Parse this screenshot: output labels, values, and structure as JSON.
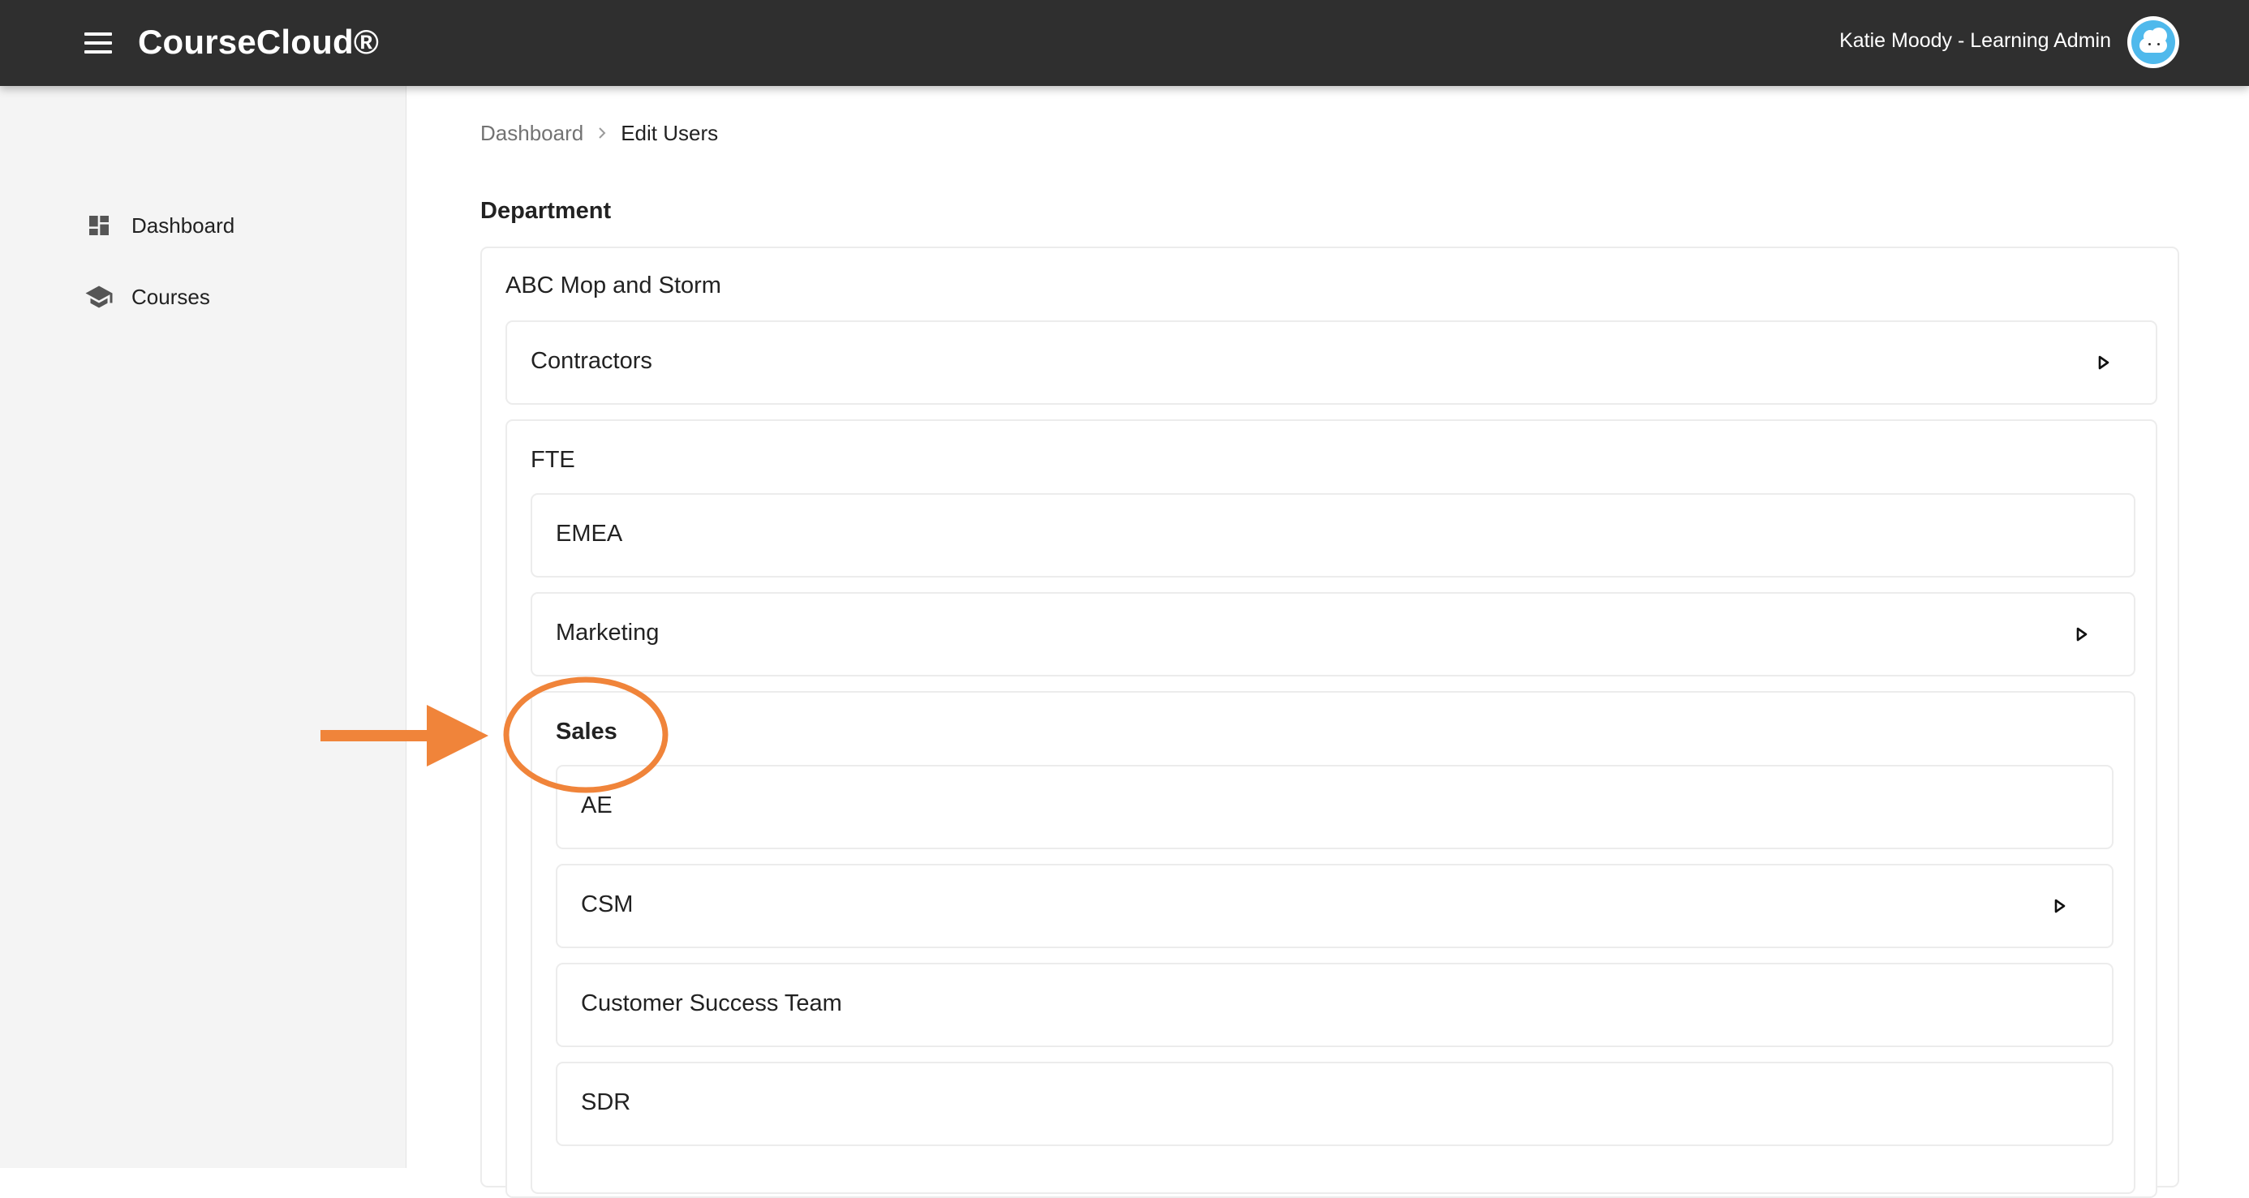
{
  "header": {
    "brand": "CourseCloud®",
    "user": "Katie Moody - Learning Admin"
  },
  "sidebar": {
    "items": [
      {
        "label": "Dashboard",
        "icon": "dashboard-icon"
      },
      {
        "label": "Courses",
        "icon": "graduation-cap-icon"
      }
    ]
  },
  "main": {
    "title": "Dashboard - Edit Users",
    "breadcrumb": {
      "parent": "Dashboard",
      "current": "Edit Users"
    },
    "section_label": "Department",
    "tree": {
      "root": "ABC Mop and Storm",
      "contractors": "Contractors",
      "fte": "FTE",
      "emea": "EMEA",
      "marketing": "Marketing",
      "sales": "Sales",
      "sales_children": [
        "AE",
        "CSM",
        "Customer Success Team",
        "SDR"
      ]
    }
  },
  "colors": {
    "topbar": "#2f2f2f",
    "sidebar": "#f4f4f4",
    "annotation": "#f0843a",
    "avatar": "#4fb9ec"
  }
}
